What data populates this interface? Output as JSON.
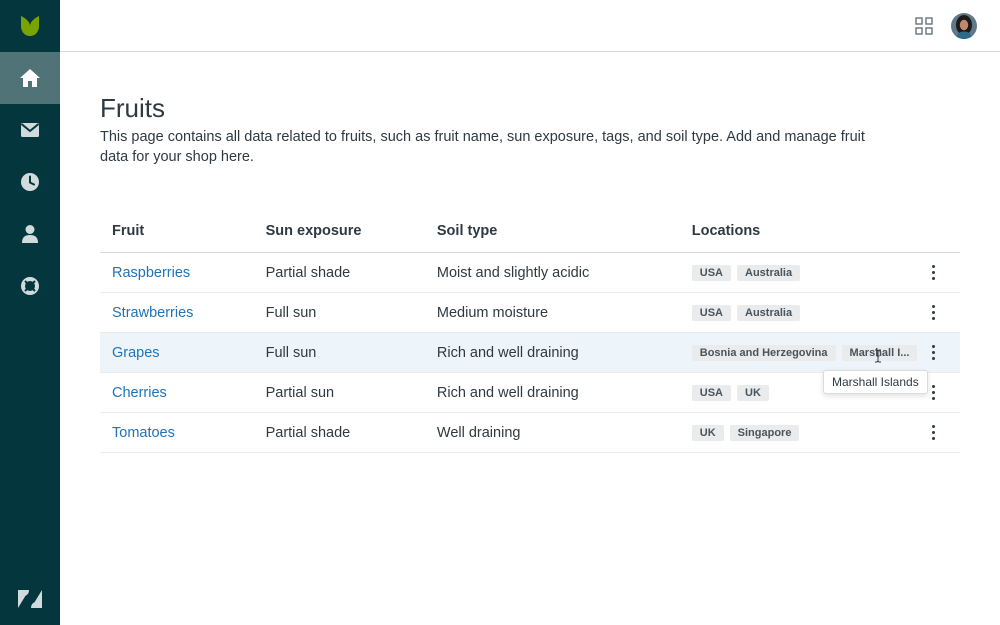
{
  "header": {
    "apps_icon": "grid-icon",
    "avatar_icon": "user-avatar"
  },
  "sidebar": {
    "logo": "leaf-logo",
    "items": [
      {
        "icon": "home-icon",
        "active": true
      },
      {
        "icon": "mail-icon",
        "active": false
      },
      {
        "icon": "clock-icon",
        "active": false
      },
      {
        "icon": "person-icon",
        "active": false
      },
      {
        "icon": "lifebuoy-icon",
        "active": false
      }
    ],
    "footer_logo": "zendesk-logo"
  },
  "page": {
    "title": "Fruits",
    "description": "This page contains all data related to fruits, such as fruit name, sun exposure, tags, and soil type. Add and manage fruit data for your shop here."
  },
  "table": {
    "columns": [
      "Fruit",
      "Sun exposure",
      "Soil type",
      "Locations"
    ],
    "rows": [
      {
        "fruit": "Raspberries",
        "sun": "Partial shade",
        "soil": "Moist and slightly acidic",
        "locations": [
          "USA",
          "Australia"
        ]
      },
      {
        "fruit": "Strawberries",
        "sun": "Full sun",
        "soil": "Medium moisture",
        "locations": [
          "USA",
          "Australia"
        ]
      },
      {
        "fruit": "Grapes",
        "sun": "Full sun",
        "soil": "Rich and well draining",
        "locations": [
          "Bosnia and Herzegovina",
          "Marshall I..."
        ]
      },
      {
        "fruit": "Cherries",
        "sun": "Partial sun",
        "soil": "Rich and well draining",
        "locations": [
          "USA",
          "UK"
        ]
      },
      {
        "fruit": "Tomatoes",
        "sun": "Partial shade",
        "soil": "Well draining",
        "locations": [
          "UK",
          "Singapore"
        ]
      }
    ]
  },
  "tooltip": {
    "text": "Marshall Islands"
  },
  "colors": {
    "sidebar": "#03363d",
    "active_nav": "#4f7377",
    "link": "#1f73b7",
    "hover_row": "#edf4fa"
  }
}
